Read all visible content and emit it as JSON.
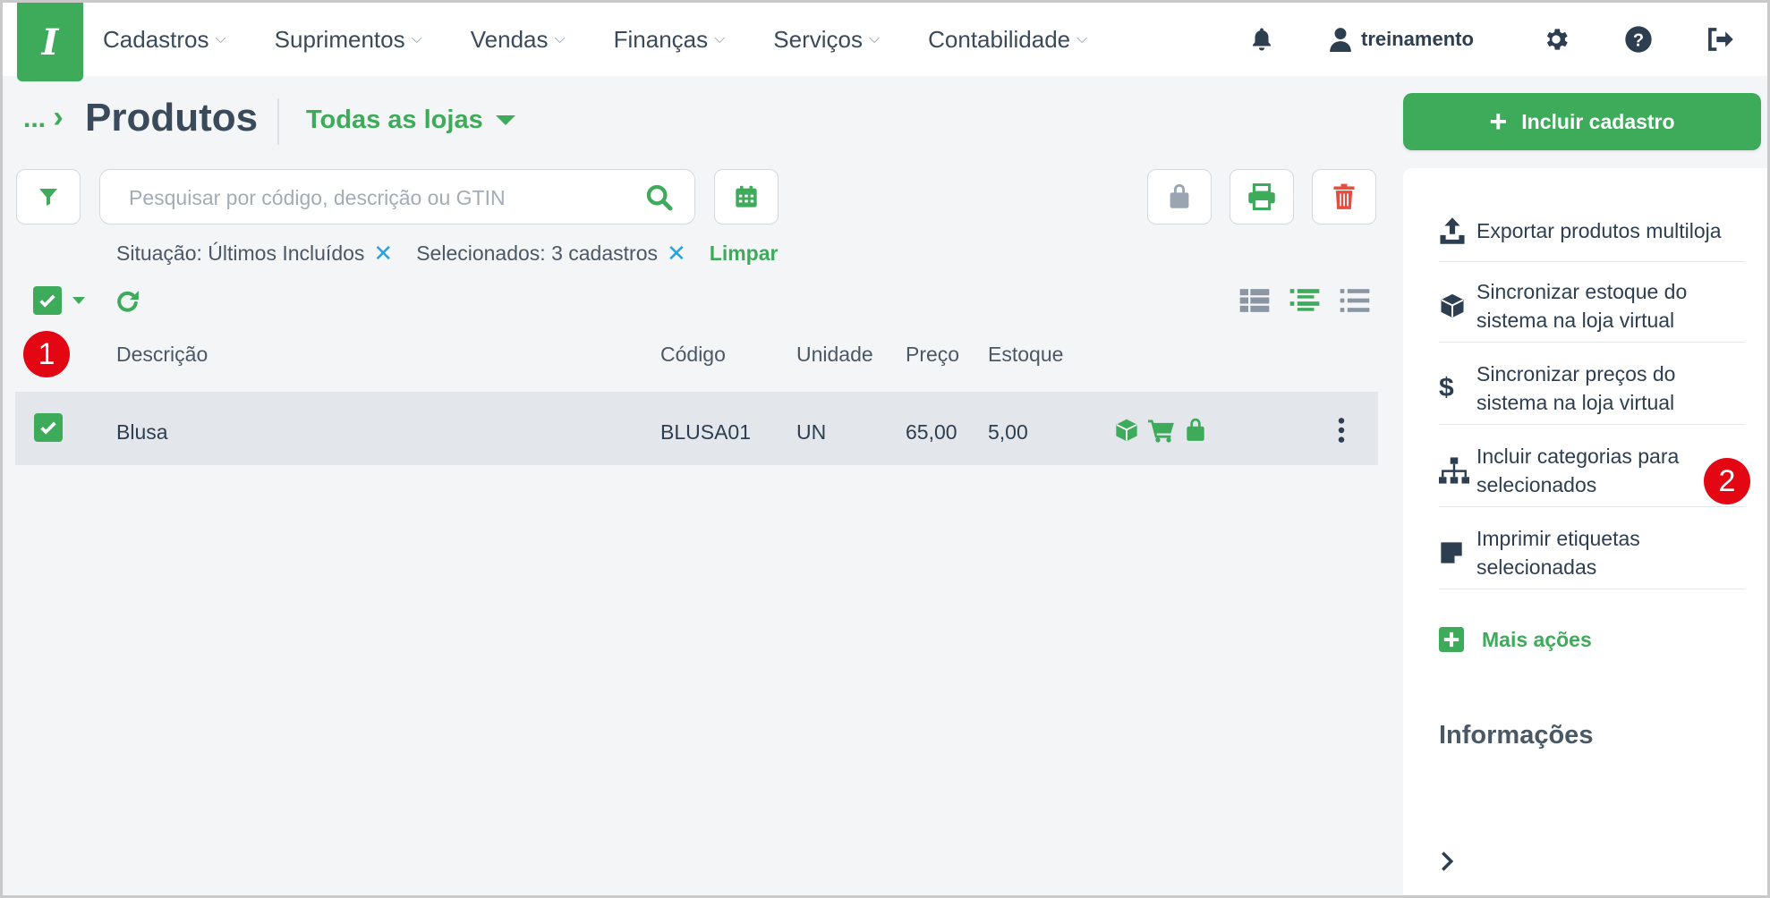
{
  "brand": {
    "logo_text": "I"
  },
  "nav": {
    "menu": [
      {
        "label": "Cadastros"
      },
      {
        "label": "Suprimentos"
      },
      {
        "label": "Vendas"
      },
      {
        "label": "Finanças"
      },
      {
        "label": "Serviços"
      },
      {
        "label": "Contabilidade"
      }
    ],
    "user": "treinamento"
  },
  "header": {
    "breadcrumb": "...",
    "title": "Produtos",
    "store_selector": "Todas as lojas"
  },
  "search": {
    "placeholder": "Pesquisar por código, descrição ou GTIN",
    "value": ""
  },
  "filters": {
    "situacao": "Situação: Últimos Incluídos",
    "selecionados": "Selecionados: 3 cadastros",
    "clear_label": "Limpar"
  },
  "table": {
    "columns": [
      "Descrição",
      "Código",
      "Unidade",
      "Preço",
      "Estoque"
    ],
    "rows": [
      {
        "descricao": "Blusa",
        "codigo": "BLUSA01",
        "unidade": "UN",
        "preco": "65,00",
        "estoque": "5,00",
        "selected": true
      }
    ]
  },
  "annotations": {
    "badge1": "1",
    "badge2": "2"
  },
  "sidebar": {
    "primary_button": "Incluir cadastro",
    "actions": [
      {
        "label": "Exportar produtos multiloja",
        "icon": "upload-icon"
      },
      {
        "label": "Sincronizar estoque do sistema na loja virtual",
        "icon": "box-icon"
      },
      {
        "label": "Sincronizar preços do sistema na loja virtual",
        "icon": "dollar-icon"
      },
      {
        "label": "Incluir categorias para selecionados",
        "icon": "sitemap-icon"
      },
      {
        "label": "Imprimir etiquetas selecionadas",
        "icon": "note-icon"
      }
    ],
    "more_actions": "Mais ações",
    "info_title": "Informações"
  },
  "colors": {
    "brand_green": "#3eab5b",
    "danger_red": "#e74c3c",
    "info_blue": "#2aa3dc",
    "badge_red": "#e30613"
  }
}
